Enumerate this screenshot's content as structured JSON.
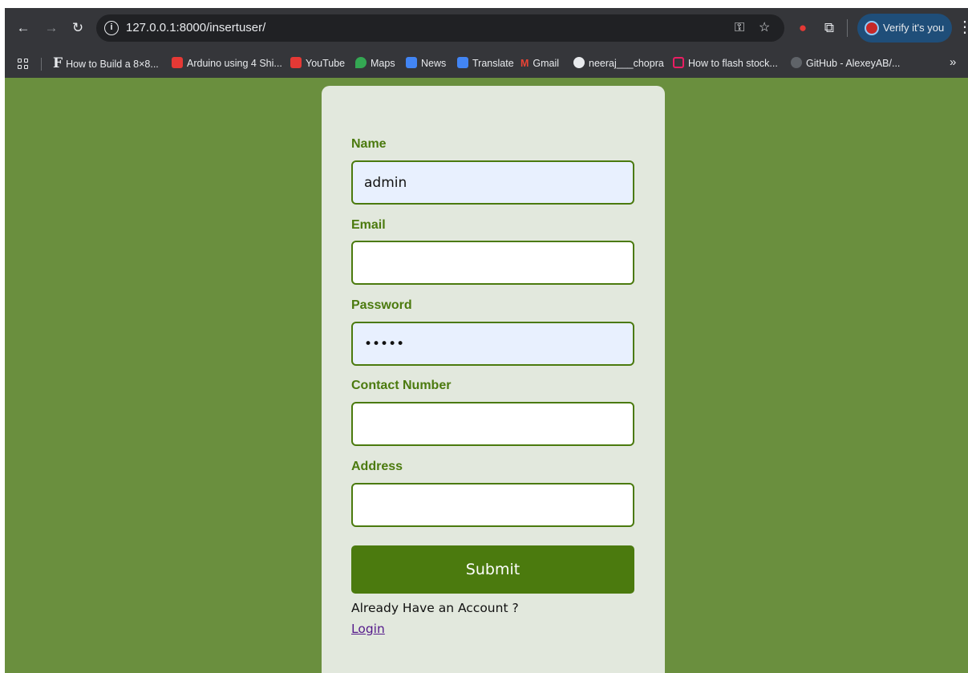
{
  "browser": {
    "url": "127.0.0.1:8000/insertuser/",
    "profile_button": "Verify it's you",
    "nav_icons": [
      "back-icon",
      "forward-icon",
      "reload-icon"
    ],
    "toolbar_icons": [
      "password-key-icon",
      "bookmark-star-icon",
      "extension-icon",
      "puzzle-icon",
      "menu-icon"
    ]
  },
  "bookmarks": [
    {
      "label": "How to Build a 8×8...",
      "icon": "f-icon"
    },
    {
      "label": "Arduino using 4 Shi...",
      "icon": "youtube-icon"
    },
    {
      "label": "YouTube",
      "icon": "youtube-icon"
    },
    {
      "label": "Maps",
      "icon": "maps-icon"
    },
    {
      "label": "News",
      "icon": "news-icon"
    },
    {
      "label": "Translate",
      "icon": "translate-icon"
    },
    {
      "label": "Gmail",
      "icon": "gmail-icon"
    },
    {
      "label": "neeraj___chopra",
      "icon": "globe-icon"
    },
    {
      "label": "How to flash stock...",
      "icon": "bracket-icon"
    },
    {
      "label": "GitHub - AlexeyAB/...",
      "icon": "github-icon"
    }
  ],
  "form": {
    "fields": [
      {
        "label": "Name",
        "value": "admin",
        "type": "text"
      },
      {
        "label": "Email",
        "value": "",
        "type": "email"
      },
      {
        "label": "Password",
        "value": "admin",
        "type": "password"
      },
      {
        "label": "Contact Number",
        "value": "",
        "type": "text"
      },
      {
        "label": "Address",
        "value": "",
        "type": "text"
      }
    ],
    "submit_label": "Submit",
    "account_prompt": "Already Have an Account ?",
    "login_link": "Login"
  },
  "colors": {
    "page_background": "#6a8f3e",
    "card_background": "#e2e8dd",
    "accent": "#4b7a0e",
    "autofill": "#e8f0fe",
    "link": "#551a8b"
  }
}
